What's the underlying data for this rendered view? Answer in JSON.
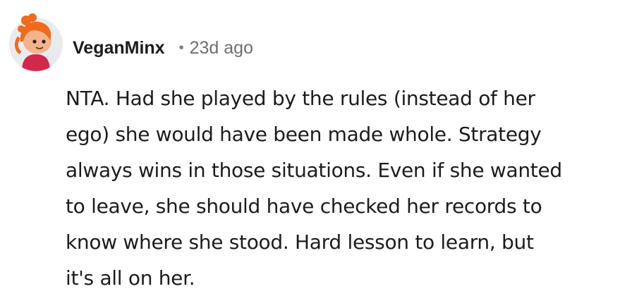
{
  "comment": {
    "avatar_icon": "snoo-avatar-icon",
    "username": "VeganMinx",
    "separator": "•",
    "timestamp": "23d ago",
    "body_lines": [
      "NTA. Had she played by the rules (instead of her",
      "ego) she would have been made whole. Strategy",
      "always wins in those situations. Even if she wanted",
      "to leave, she should have checked her records to",
      "know where she stood. Hard lesson to learn, but",
      "it's all on her."
    ]
  },
  "colors": {
    "background": "#ffffff",
    "text": "#1c1c1c",
    "muted": "#6f6f6f",
    "avatar_bg": "#e9ecee",
    "hair": "#f26a1b",
    "shirt": "#d4284a"
  }
}
